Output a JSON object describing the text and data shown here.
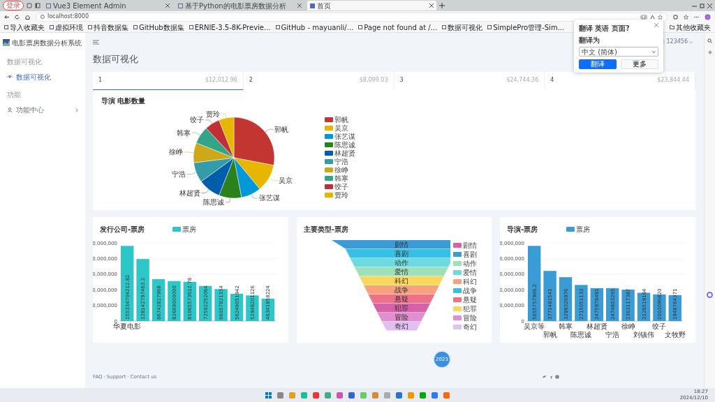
{
  "browser": {
    "profile": "登录",
    "tabs": [
      {
        "title": "Vue3 Element Admin",
        "selected": false
      },
      {
        "title": "基于Python的电影票房数据分析",
        "selected": false
      },
      {
        "title": "首页",
        "selected": true
      }
    ],
    "address": "localhost:8000",
    "bookmarks": [
      "导入收藏夹",
      "虚拟环境",
      "抖音数据集",
      "GitHub数据集",
      "ERNIE-3.5-8K-Previe...",
      "GitHub - mayuanli/...",
      "Page not found at /...",
      "数据可视化",
      "SimplePro管理-Sim..."
    ],
    "other_bookmarks": "其他收藏夹"
  },
  "translate_popup": {
    "title": "翻译 英语 页面?",
    "label": "翻译为",
    "language": "中文 (简体)",
    "buttons": [
      "翻译",
      "更多"
    ]
  },
  "sidebar": {
    "brand": "电影票房数据分析系统",
    "sections": [
      {
        "heading": "数据可视化",
        "items": [
          {
            "label": "数据可视化",
            "selected": true,
            "expandable": false
          }
        ]
      },
      {
        "heading": "功能",
        "items": [
          {
            "label": "功能中心",
            "selected": false,
            "expandable": true
          }
        ]
      }
    ]
  },
  "header": {
    "user": "123456"
  },
  "page_title": "数据可视化",
  "stat_tabs": [
    {
      "label": "1",
      "amount": "$12,012.96",
      "selected": true
    },
    {
      "label": "2",
      "amount": "$8,099.03",
      "selected": false
    },
    {
      "label": "3",
      "amount": "$24,744.36",
      "selected": false
    },
    {
      "label": "4",
      "amount": "$23,844.44",
      "selected": false
    }
  ],
  "pie_card": {
    "title": "导演 电影数量",
    "chart_data": {
      "type": "pie",
      "categories": [
        "郭帆",
        "吴京",
        "张艺谋",
        "陈思诚",
        "林超贤",
        "宁浩",
        "徐峥",
        "韩寒",
        "饺子",
        "贾玲"
      ],
      "values": [
        28,
        11,
        8,
        9,
        9,
        8,
        8,
        7,
        6,
        6
      ]
    },
    "legend": [
      {
        "label": "郭帆",
        "color": "#c23531"
      },
      {
        "label": "吴京",
        "color": "#e6b600"
      },
      {
        "label": "张艺谋",
        "color": "#0098d9"
      },
      {
        "label": "陈思诚",
        "color": "#2b821d"
      },
      {
        "label": "林超贤",
        "color": "#005eaa"
      },
      {
        "label": "宁浩",
        "color": "#339ca8"
      },
      {
        "label": "徐峥",
        "color": "#cda819"
      },
      {
        "label": "韩寒",
        "color": "#32a487"
      },
      {
        "label": "饺子",
        "color": "#c12e34"
      },
      {
        "label": "贾玲",
        "color": "#e6b600"
      }
    ]
  },
  "company_card": {
    "chart_data": {
      "type": "bar",
      "title": "发行公司-票房",
      "categories": [
        "华夏电影",
        null,
        null,
        null,
        null,
        null,
        null,
        null,
        null,
        null
      ],
      "series": [
        {
          "name": "票房",
          "color": "#2ec7c9",
          "values": [
            155334704212.82,
            128142797463.2,
            86742827968,
            82669000000,
            81065573612.78,
            72592252064,
            66057821154,
            56249051942,
            52948201126,
            46341858224
          ]
        }
      ],
      "data_labels": true
    },
    "y_axis_labels": [
      "0,000,000",
      "0,000,000",
      "0,000,000",
      "0,000,000",
      "0,000,000",
      "0"
    ]
  },
  "genre_card": {
    "title": "主要类型-票房",
    "segments": [
      {
        "label": "剧情",
        "color": "#3a9bd5"
      },
      {
        "label": "喜剧",
        "color": "#36c0e6"
      },
      {
        "label": "动作",
        "color": "#6ddae0"
      },
      {
        "label": "爱情",
        "color": "#a0e0b8"
      },
      {
        "label": "科幻",
        "color": "#fbd85c"
      },
      {
        "label": "战争",
        "color": "#f9a07c"
      },
      {
        "label": "悬疑",
        "color": "#f0708a"
      },
      {
        "label": "犯罪",
        "color": "#d860a8"
      },
      {
        "label": "冒险",
        "color": "#e090d0"
      },
      {
        "label": "奇幻",
        "color": "#e0c0f0"
      }
    ],
    "legend": [
      {
        "label": "剧情",
        "color": "#d860a8"
      },
      {
        "label": "喜剧",
        "color": "#3a9bd5"
      },
      {
        "label": "动作",
        "color": "#a0e0b8"
      },
      {
        "label": "爱情",
        "color": "#6ddae0"
      },
      {
        "label": "科幻",
        "color": "#f9a07c"
      },
      {
        "label": "战争",
        "color": "#36c0e6"
      },
      {
        "label": "悬疑",
        "color": "#f0708a"
      },
      {
        "label": "犯罪",
        "color": "#fbd85c"
      },
      {
        "label": "冒险",
        "color": "#e090d0"
      },
      {
        "label": "奇幻",
        "color": "#e0c0f0"
      }
    ]
  },
  "director_card": {
    "chart_data": {
      "type": "bar",
      "title": "导演-票房",
      "categories": [
        "吴京等",
        "郭帆",
        "韩寒",
        "陈思诚",
        "林超贤",
        "宁浩",
        "徐峥",
        "刘镇伟",
        "饺子",
        "文牧野"
      ],
      "series": [
        {
          "name": "票房",
          "color": "#3a9bd5",
          "values": [
            5655757966.2,
            3771481541,
            3299326976,
            2715051133,
            2475978491,
            2474803265,
            2363117387,
            2126519184,
            2003096820,
            1948764371
          ]
        }
      ],
      "data_labels": true
    },
    "y_axis_labels": [
      "0,000,000",
      "0,000,000",
      "0,000,000",
      "0,000,000",
      "0,000,000",
      "0"
    ]
  },
  "float_button": "2023",
  "footer": {
    "links": [
      "FAQ",
      "Support",
      "Contact us"
    ],
    "separators": [
      "·",
      "·"
    ]
  },
  "taskbar": {
    "time": "18:27",
    "date": "2024/12/10"
  }
}
